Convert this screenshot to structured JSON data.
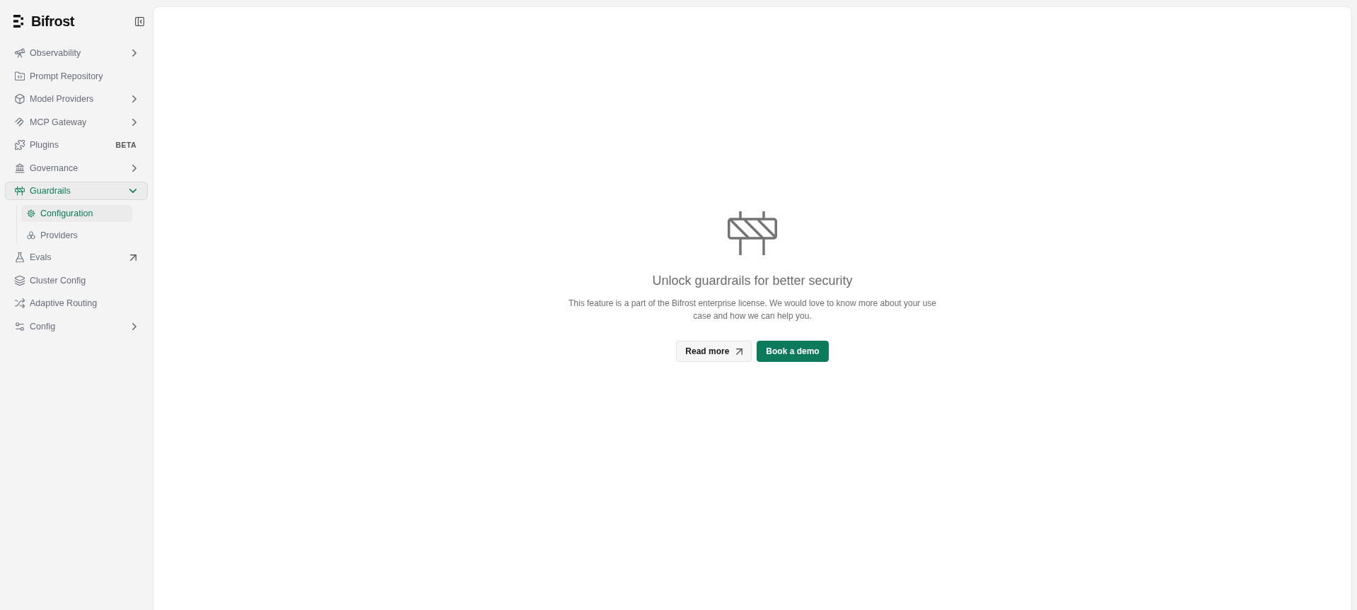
{
  "sidebar": {
    "brand": "Bifrost",
    "items": [
      {
        "label": "Observability",
        "kind": "group",
        "expanded": false,
        "selected": false
      },
      {
        "label": "Prompt Repository",
        "kind": "link",
        "selected": false
      },
      {
        "label": "Model Providers",
        "kind": "group",
        "expanded": false,
        "selected": false
      },
      {
        "label": "MCP Gateway",
        "kind": "group",
        "expanded": false,
        "selected": false
      },
      {
        "label": "Plugins",
        "kind": "badge",
        "badge": "BETA",
        "selected": false
      },
      {
        "label": "Governance",
        "kind": "group",
        "expanded": false,
        "selected": false
      },
      {
        "label": "Guardrails",
        "kind": "group",
        "expanded": true,
        "selected": true,
        "children": [
          {
            "label": "Configuration",
            "selected": true
          },
          {
            "label": "Providers",
            "selected": false
          }
        ]
      },
      {
        "label": "Evals",
        "kind": "external",
        "selected": false
      },
      {
        "label": "Cluster Config",
        "kind": "link",
        "selected": false
      },
      {
        "label": "Adaptive Routing",
        "kind": "link",
        "selected": false
      },
      {
        "label": "Config",
        "kind": "group",
        "expanded": false,
        "selected": false
      }
    ]
  },
  "main": {
    "title": "Unlock guardrails for better security",
    "description": "This feature is a part of the Bifrost enterprise license. We would love to know more about your use case and how we can help you.",
    "buttons": [
      {
        "label": "Read more",
        "kind": "secondary"
      },
      {
        "label": "Book a demo",
        "kind": "primary"
      }
    ]
  }
}
